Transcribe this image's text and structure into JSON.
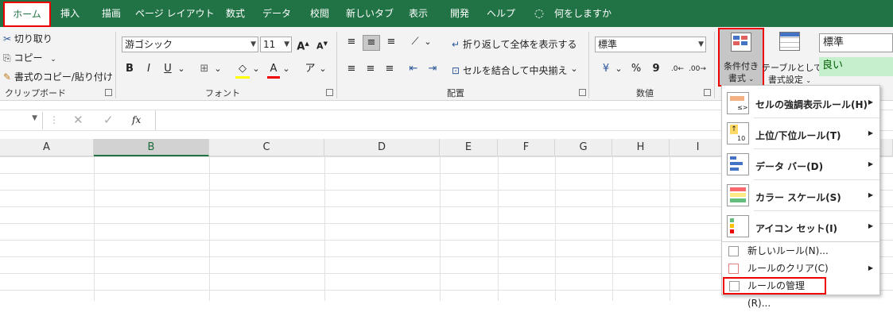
{
  "tabs": [
    "ホーム",
    "挿入",
    "描画",
    "ページ レイアウト",
    "数式",
    "データ",
    "校閲",
    "新しいタブ",
    "表示",
    "開発",
    "ヘルプ"
  ],
  "tell_me": "何をしますか",
  "clipboard": {
    "cut": "切り取り",
    "copy": "コピー",
    "format_painter": "書式のコピー/貼り付け",
    "group_label": "クリップボード"
  },
  "font": {
    "name": "游ゴシック",
    "size": "11",
    "group_label": "フォント",
    "grow": "A",
    "shrink": "A",
    "bold": "B",
    "italic": "I",
    "underline": "U",
    "font_color": "A"
  },
  "alignment": {
    "wrap": "折り返して全体を表示する",
    "merge": "セルを結合して中央揃え",
    "group_label": "配置"
  },
  "number": {
    "format": "標準",
    "group_label": "数値",
    "percent": "%",
    "comma": "9"
  },
  "styles": {
    "cond_format_line1": "条件付き",
    "cond_format_line2": "書式",
    "table_line1": "テーブルとして",
    "table_line2": "書式設定",
    "style_normal": "標準",
    "style_good": "良い"
  },
  "formula_bar": {
    "fx": "fx"
  },
  "columns": [
    "A",
    "B",
    "C",
    "D",
    "E",
    "F",
    "G",
    "H",
    "I"
  ],
  "menu": {
    "items": [
      {
        "label": "セルの強調表示ルール(H)"
      },
      {
        "label": "上位/下位ルール(T)"
      },
      {
        "label": "データ バー(D)"
      },
      {
        "label": "カラー スケール(S)"
      },
      {
        "label": "アイコン セット(I)"
      }
    ],
    "new_rule": "新しいルール(N)...",
    "clear_rules": "ルールのクリア(C)",
    "manage_rules": "ルールの管理(R)..."
  },
  "colors": {
    "excel_green": "#217346",
    "highlight_red": "#e00000",
    "good_green": "#c6efce"
  }
}
